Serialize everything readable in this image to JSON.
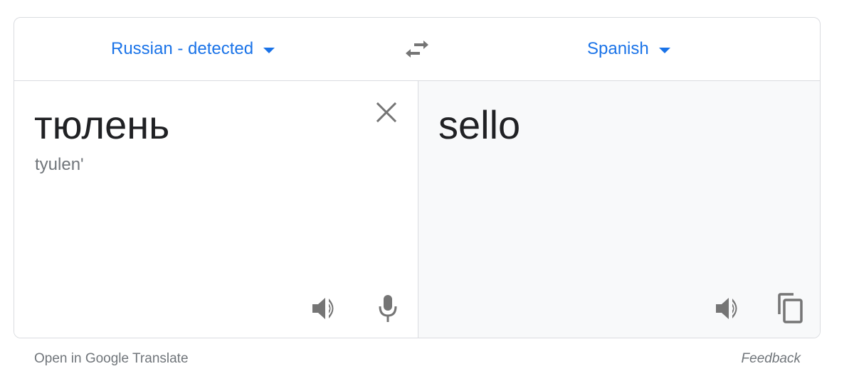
{
  "colors": {
    "accent": "#1a73e8",
    "icon": "#757575",
    "text": "#202124",
    "muted": "#70757a",
    "target_bg": "#f8f9fa",
    "border": "#dadce0"
  },
  "header": {
    "source_language": "Russian - detected",
    "target_language": "Spanish",
    "swap_icon": "swap-horizontal-icon",
    "dropdown_icon": "caret-down-icon"
  },
  "source": {
    "text": "тюлень",
    "transliteration": "tyulen'",
    "clear_icon": "close-icon",
    "listen_icon": "speaker-icon",
    "mic_icon": "microphone-icon"
  },
  "target": {
    "text": "sello",
    "listen_icon": "speaker-icon",
    "copy_icon": "copy-icon"
  },
  "footer": {
    "open_link": "Open in Google Translate",
    "feedback": "Feedback"
  }
}
